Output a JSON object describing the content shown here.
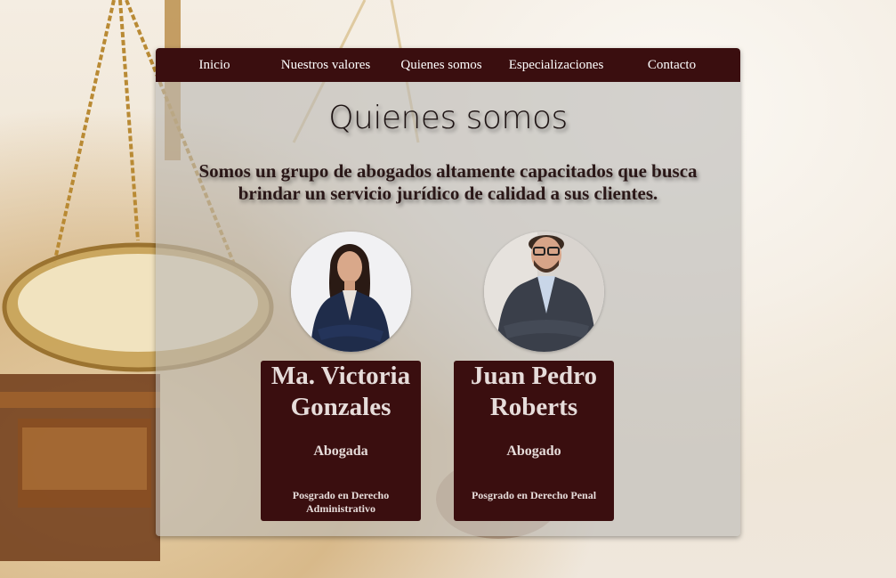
{
  "nav": {
    "items": [
      {
        "label": "Inicio"
      },
      {
        "label": "Nuestros valores"
      },
      {
        "label": "Quienes somos"
      },
      {
        "label": "Especializaciones"
      },
      {
        "label": "Contacto"
      }
    ]
  },
  "main": {
    "title": "Quienes somos",
    "intro": "Somos un grupo de abogados altamente capacitados que busca brindar un servicio jurídico de calidad a sus clientes."
  },
  "team": [
    {
      "name": "Ma. Victoria Gonzales",
      "role": "Abogada",
      "specialization": "Posgrado en Derecho Administrativo"
    },
    {
      "name": "Juan Pedro Roberts",
      "role": "Abogado",
      "specialization": "Posgrado en Derecho Penal"
    }
  ],
  "colors": {
    "primary": "#3a0e0f",
    "panel": "#bcbab7",
    "nav_text": "#ffffff",
    "card_text": "#e6dcda"
  }
}
